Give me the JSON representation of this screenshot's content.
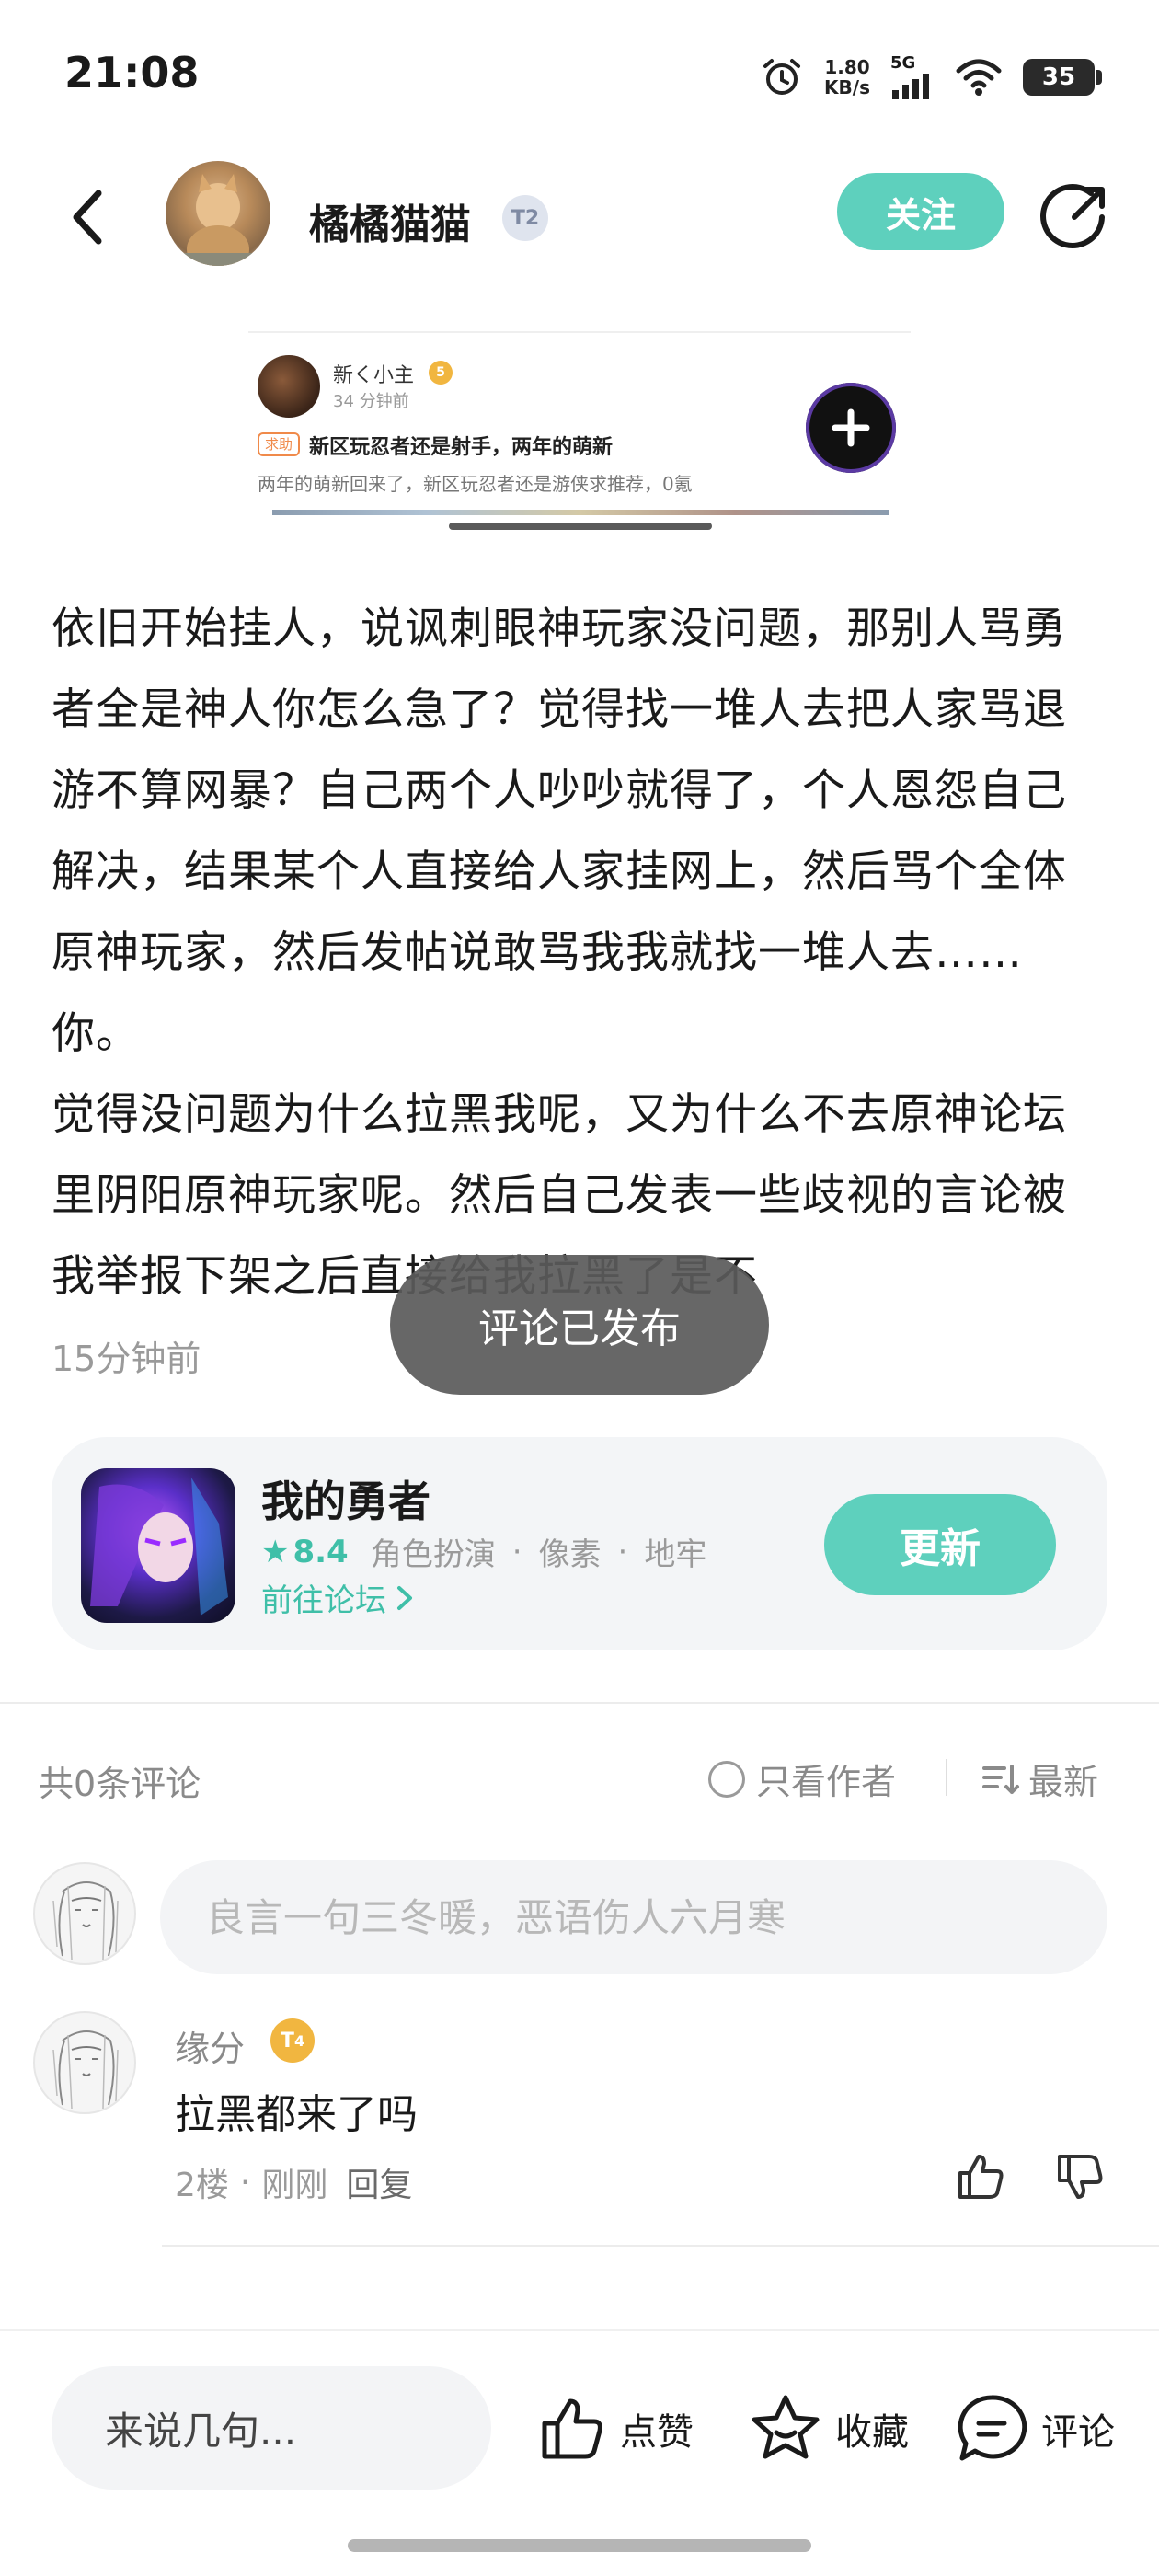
{
  "status_bar": {
    "time": "21:08",
    "net_speed_value": "1.80",
    "net_speed_unit": "KB/s",
    "network": "5G",
    "battery": "35"
  },
  "header": {
    "author_name": "橘橘猫猫",
    "author_level": "2",
    "follow_label": "关注"
  },
  "preview": {
    "user": "新く小主",
    "user_level": "5",
    "time": "34 分钟前",
    "tag": "求助",
    "title": "新区玩忍者还是射手，两年的萌新",
    "desc": "两年的萌新回来了，新区玩忍者还是游侠求推荐，0氪"
  },
  "post": {
    "paragraph1": "依旧开始挂人，说讽刺眼神玩家没问题，那别人骂勇者全是神人你怎么急了？觉得找一堆人去把人家骂退游不算网暴？自己两个人吵吵就得了，个人恩怨自己解决，结果某个人直接给人家挂网上，然后骂个全体原神玩家，然后发帖说敢骂我我就找一堆人去……你。",
    "paragraph2": "觉得没问题为什么拉黑我呢，又为什么不去原神论坛里阴阳原神玩家呢。然后自己发表一些歧视的言论被我举报下架之后直接给我拉黑了是不",
    "time": "15分钟前"
  },
  "toast": "评论已发布",
  "game": {
    "name": "我的勇者",
    "rating": "8.4",
    "genres": [
      "角色扮演",
      "像素",
      "地牢"
    ],
    "forum_link": "前往论坛",
    "update_label": "更新"
  },
  "comments_header": {
    "count_text": "共0条评论",
    "only_author": "只看作者",
    "sort": "最新"
  },
  "comment_input": {
    "placeholder": "良言一句三冬暖，恶语伤人六月寒"
  },
  "comments": [
    {
      "name": "缘分",
      "level": "4",
      "text": "拉黑都来了吗",
      "floor": "2楼",
      "time": "刚刚",
      "reply": "回复"
    }
  ],
  "bottom_bar": {
    "say_placeholder": "来说几句...",
    "like": "点赞",
    "favorite": "收藏",
    "comment": "评论"
  },
  "colors": {
    "accent": "#5ed0bd",
    "accent_text": "#3fbfa8",
    "level_gold": "#f1b640"
  }
}
